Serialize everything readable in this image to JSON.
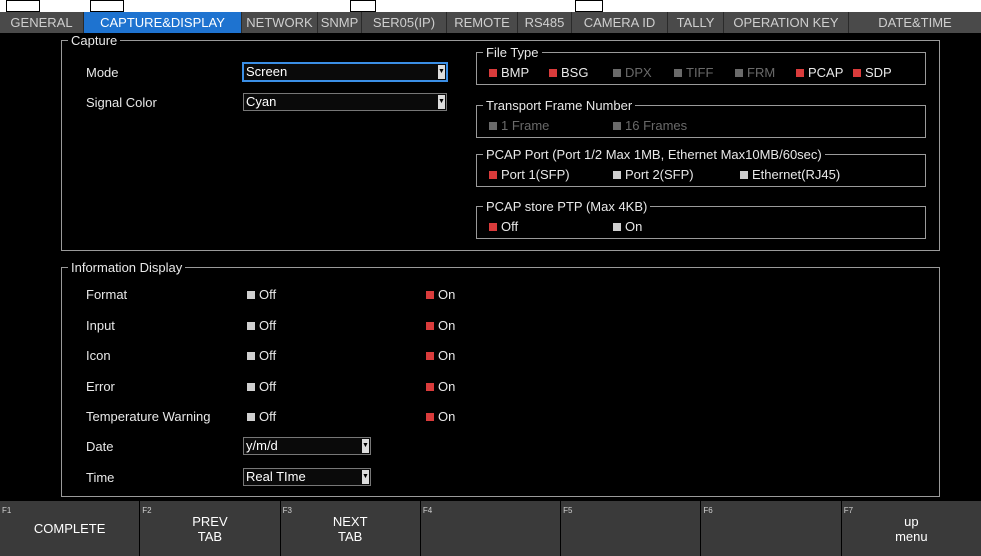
{
  "tabs": [
    "GENERAL",
    "CAPTURE&DISPLAY",
    "NETWORK",
    "SNMP",
    "SER05(IP)",
    "REMOTE",
    "RS485",
    "CAMERA ID",
    "TALLY",
    "OPERATION KEY",
    "DATE&TIME"
  ],
  "active_tab": "CAPTURE&DISPLAY",
  "capture": {
    "legend": "Capture",
    "mode_label": "Mode",
    "mode_value": "Screen",
    "signal_color_label": "Signal Color",
    "signal_color_value": "Cyan"
  },
  "file_type": {
    "legend": "File Type",
    "options": [
      {
        "label": "BMP",
        "checked": true,
        "enabled": true
      },
      {
        "label": "BSG",
        "checked": true,
        "enabled": true
      },
      {
        "label": "DPX",
        "checked": false,
        "enabled": false
      },
      {
        "label": "TIFF",
        "checked": false,
        "enabled": false
      },
      {
        "label": "FRM",
        "checked": false,
        "enabled": false
      },
      {
        "label": "PCAP",
        "checked": true,
        "enabled": true
      },
      {
        "label": "SDP",
        "checked": true,
        "enabled": true
      }
    ]
  },
  "transport_frame": {
    "legend": "Transport Frame Number",
    "opt1": "1 Frame",
    "opt2": "16 Frames"
  },
  "pcap_port": {
    "legend": "PCAP Port (Port 1/2 Max 1MB, Ethernet Max10MB/60sec)",
    "port1": "Port 1(SFP)",
    "port2": "Port 2(SFP)",
    "ethernet": "Ethernet(RJ45)"
  },
  "pcap_ptp": {
    "legend": "PCAP store PTP (Max 4KB)",
    "off": "Off",
    "on": "On"
  },
  "info_display": {
    "legend": "Information Display",
    "off_label": "Off",
    "on_label": "On",
    "rows": [
      "Format",
      "Input",
      "Icon",
      "Error",
      "Temperature Warning"
    ],
    "date_label": "Date",
    "date_value": "y/m/d",
    "time_label": "Time",
    "time_value": "Real TIme"
  },
  "fkeys": [
    {
      "fn": "F1",
      "label": "COMPLETE"
    },
    {
      "fn": "F2",
      "label": "PREV\nTAB"
    },
    {
      "fn": "F3",
      "label": "NEXT\nTAB"
    },
    {
      "fn": "F4",
      "label": ""
    },
    {
      "fn": "F5",
      "label": ""
    },
    {
      "fn": "F6",
      "label": ""
    },
    {
      "fn": "F7",
      "label": "up\nmenu"
    }
  ],
  "colors": {
    "active_tab": "#1e73d0",
    "checked": "#d93b3b",
    "panel_bg": "#000000",
    "tabbar_bg": "#4a4a4a"
  }
}
